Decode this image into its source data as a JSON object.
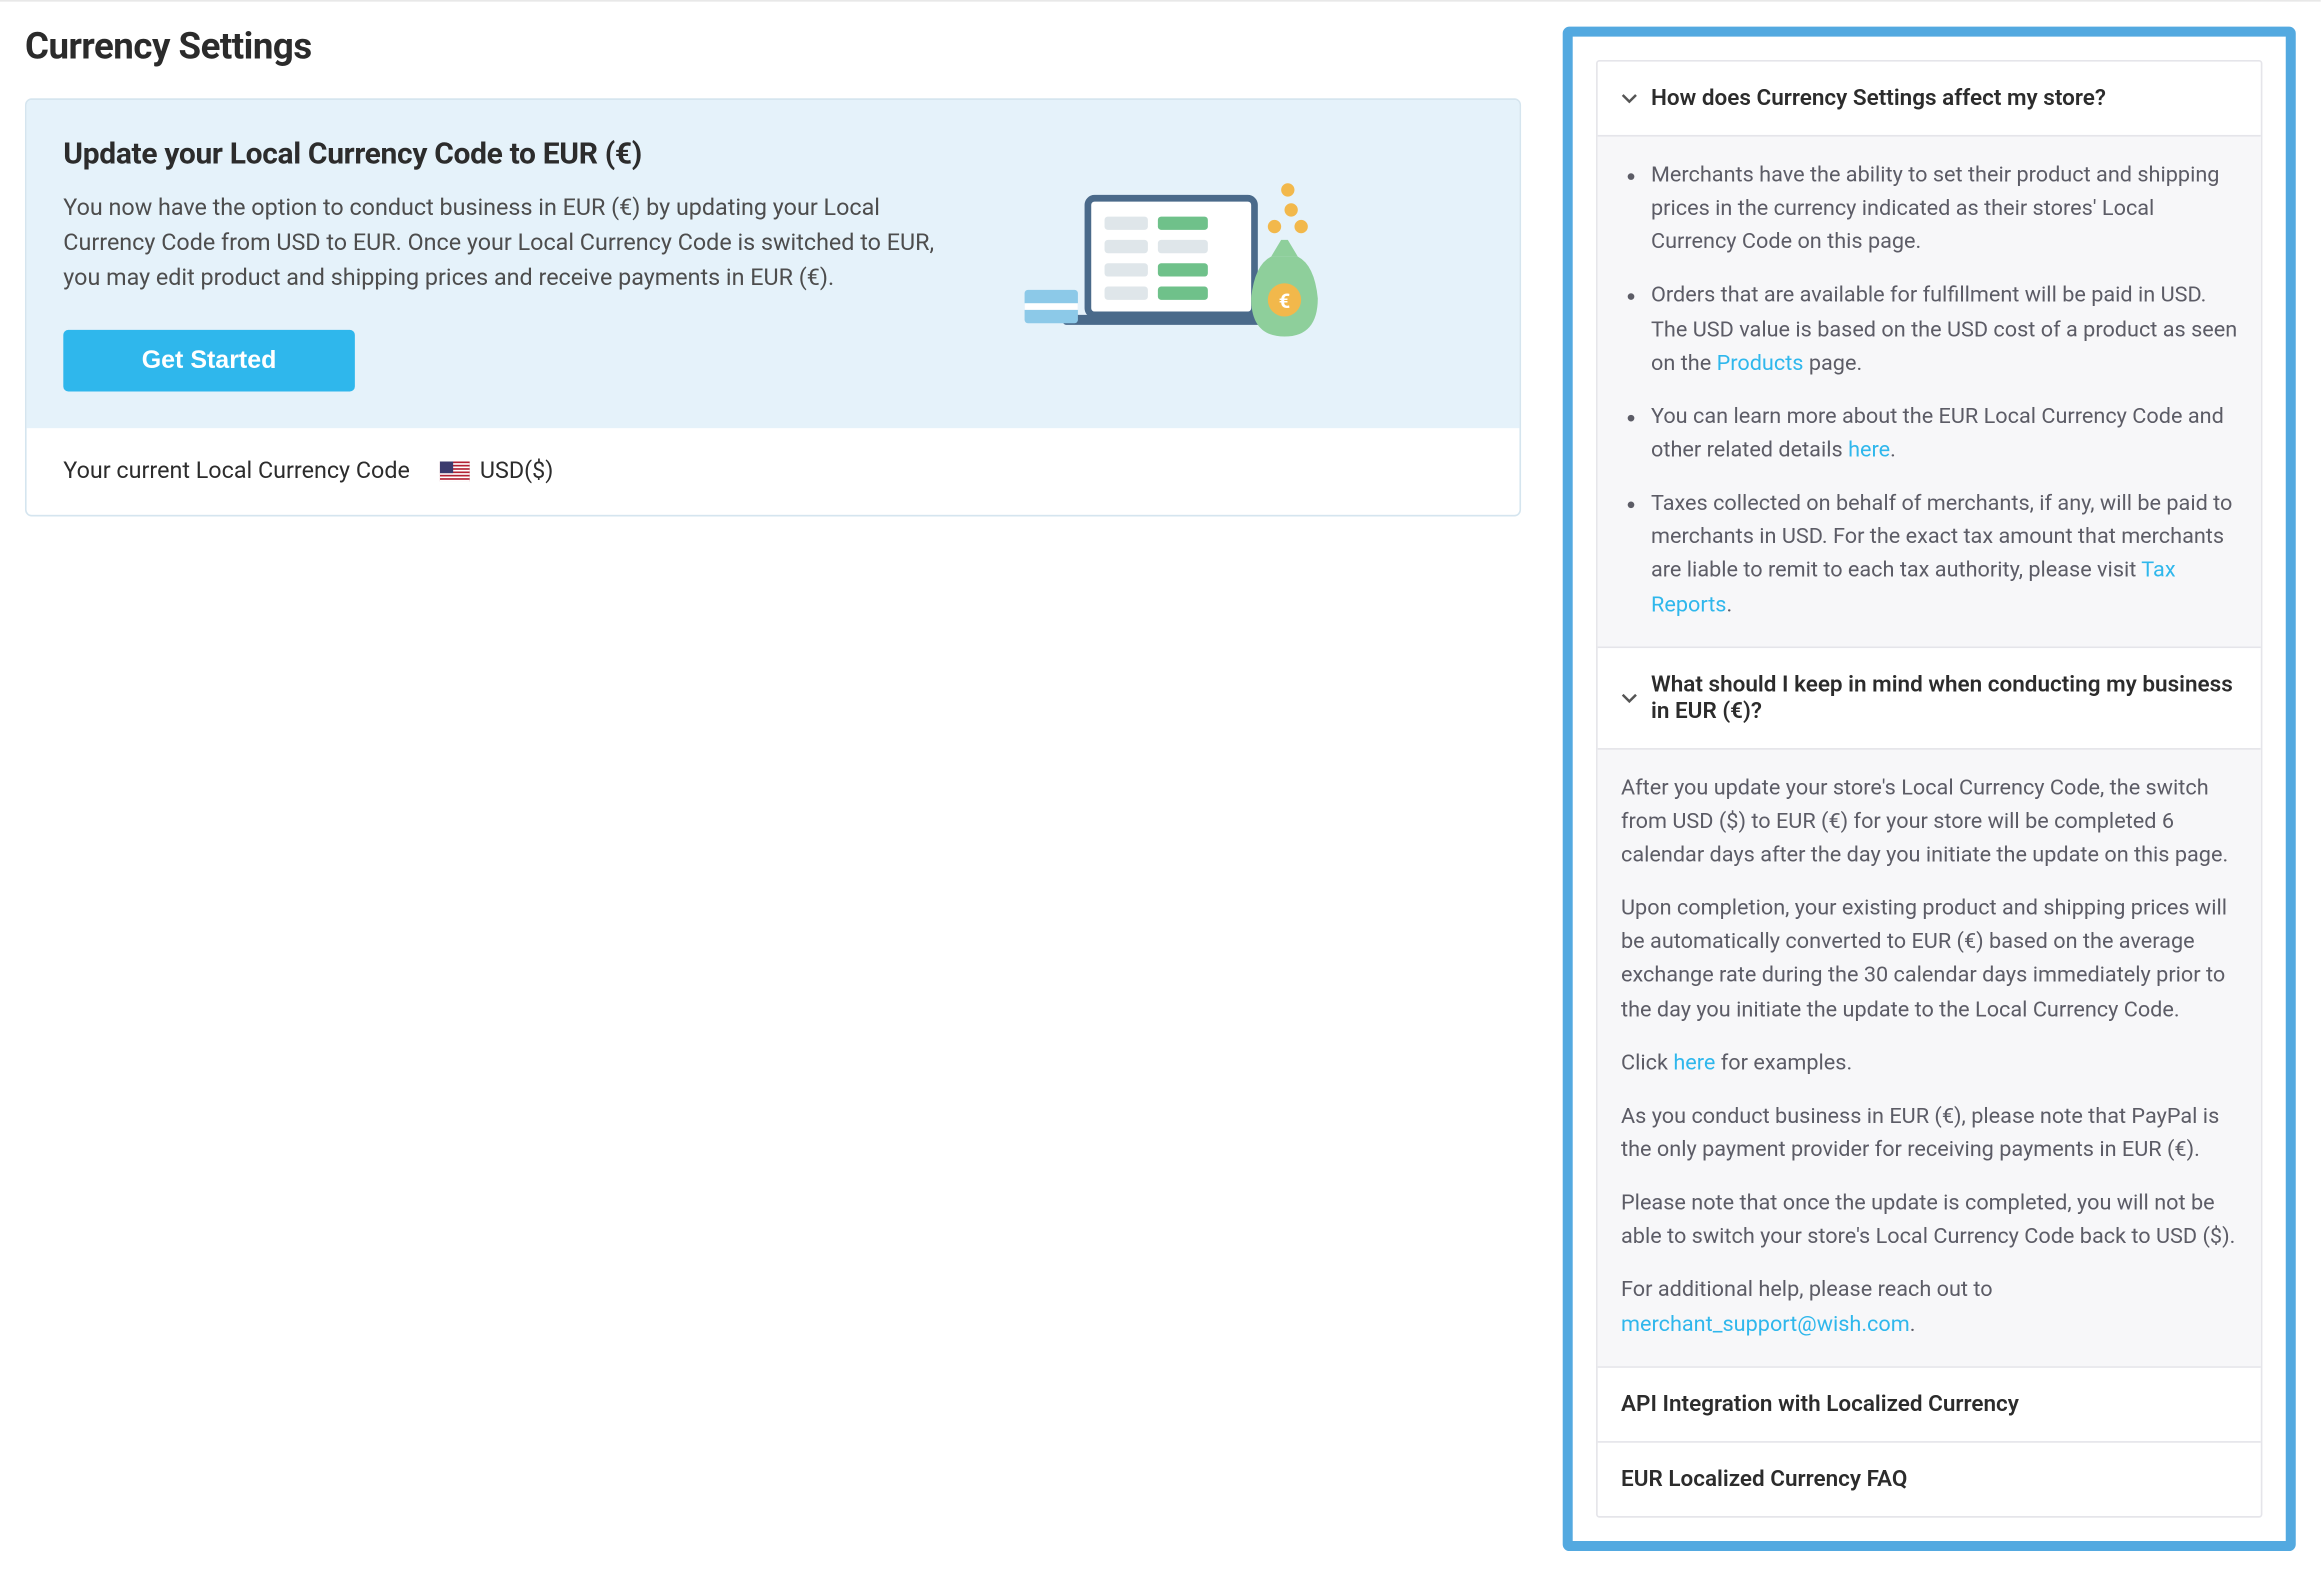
{
  "page_title": "Currency Settings",
  "update_card": {
    "title": "Update your Local Currency Code to EUR (€)",
    "description": "You now have the option to conduct business in EUR (€) by updating your Local Currency Code from USD to EUR. Once your Local Currency Code is switched to EUR, you may edit product and shipping prices and receive payments in EUR (€).",
    "button_label": "Get Started",
    "current_label": "Your current Local Currency Code",
    "current_value": "USD($)"
  },
  "faq": {
    "q1": {
      "title": "How does Currency Settings affect my store?",
      "bullet1": "Merchants have the ability to set their product and shipping prices in the currency indicated as their stores' Local Currency Code on this page.",
      "bullet2_pre": "Orders that are available for fulfillment will be paid in USD. The USD value is based on the USD cost of a product as seen on the ",
      "bullet2_link": "Products",
      "bullet2_post": " page.",
      "bullet3_pre": "You can learn more about the EUR Local Currency Code and other related details ",
      "bullet3_link": "here",
      "bullet3_post": ".",
      "bullet4_pre": "Taxes collected on behalf of merchants, if any, will be paid to merchants in USD. For the exact tax amount that merchants are liable to remit to each tax authority, please visit ",
      "bullet4_link": "Tax Reports",
      "bullet4_post": "."
    },
    "q2": {
      "title": "What should I keep in mind when conducting my business in EUR (€)?",
      "p1": "After you update your store's Local Currency Code, the switch from USD ($) to EUR (€) for your store will be completed 6 calendar days after the day you initiate the update on this page.",
      "p2": "Upon completion, your existing product and shipping prices will be automatically converted to EUR (€) based on the average exchange rate during the 30 calendar days immediately prior to the day you initiate the update to the Local Currency Code.",
      "p3_pre": "Click ",
      "p3_link": "here",
      "p3_post": " for examples.",
      "p4": "As you conduct business in EUR (€), please note that PayPal is the only payment provider for receiving payments in EUR (€).",
      "p5": "Please note that once the update is completed, you will not be able to switch your store's Local Currency Code back to USD ($).",
      "p6_pre": "For additional help, please reach out to ",
      "p6_link": "merchant_support@wish.com",
      "p6_post": "."
    },
    "q3_title": "API Integration with Localized Currency",
    "q4_title": "EUR Localized Currency FAQ"
  }
}
